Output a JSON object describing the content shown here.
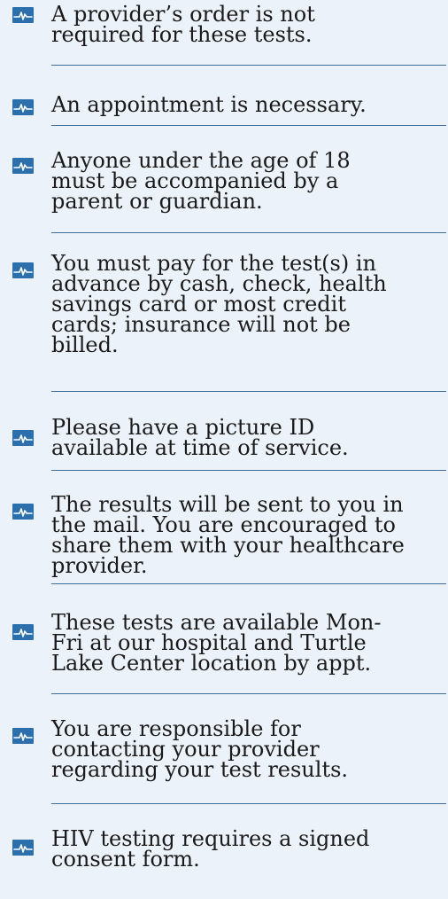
{
  "items": [
    {
      "text": "A provider’s order is not\nrequired for these tests.",
      "icon": "ekg-pulse-icon"
    },
    {
      "text": "An appointment is necessary.",
      "icon": "ekg-pulse-icon"
    },
    {
      "text": "Anyone under the age of 18\nmust be accompanied by a\nparent or guardian.",
      "icon": "ekg-pulse-icon"
    },
    {
      "text": "You must pay for the test(s) in\nadvance by cash, check, health\nsavings card or most credit\ncards; insurance will not be\nbilled.",
      "icon": "ekg-pulse-icon"
    },
    {
      "text": "Please have a picture ID\navailable at time of service.",
      "icon": "ekg-pulse-icon"
    },
    {
      "text": "The results will be sent to you in\nthe mail. You are encouraged to\nshare them with your healthcare\nprovider.",
      "icon": "ekg-pulse-icon"
    },
    {
      "text": "These tests are available Mon-\nFri at our hospital and Turtle\nLake Center location by appt.",
      "icon": "ekg-pulse-icon"
    },
    {
      "text": "You are responsible for\ncontacting your provider\nregarding your test results.",
      "icon": "ekg-pulse-icon"
    },
    {
      "text": "HIV testing requires a signed\nconsent form.",
      "icon": "ekg-pulse-icon"
    }
  ],
  "colors": {
    "background": "#ecf2f9",
    "icon_fill": "#2b6fad",
    "divider": "#3f6f96",
    "text": "#1a1a1a"
  }
}
